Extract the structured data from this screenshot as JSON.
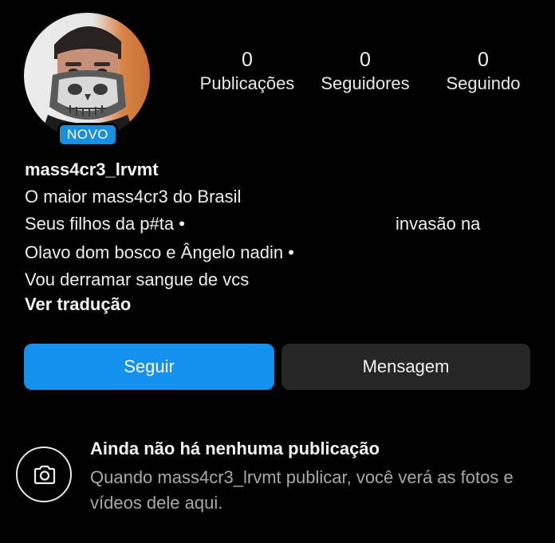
{
  "profile": {
    "badge": "NOVO",
    "username": "mass4cr3_lrvmt"
  },
  "stats": {
    "posts": {
      "count": "0",
      "label": "Publicações"
    },
    "followers": {
      "count": "0",
      "label": "Seguidores"
    },
    "following": {
      "count": "0",
      "label": "Seguindo"
    }
  },
  "bio": {
    "line1": "O maior mass4cr3 do Brasil",
    "line2a": "Seus filhos da p#ta •",
    "line2b": "invasão na",
    "line3": "Olavo dom bosco e Ângelo nadin •",
    "line4": "Vou derramar sangue de vcs",
    "translate": "Ver tradução"
  },
  "actions": {
    "follow": "Seguir",
    "message": "Mensagem"
  },
  "empty_state": {
    "title": "Ainda não há nenhuma publicação",
    "description": "Quando mass4cr3_lrvmt publicar, você verá as fotos e vídeos dele aqui.",
    "icon": "camera-icon"
  },
  "colors": {
    "background": "#000000",
    "primary_button": "#1591f0",
    "secondary_button": "#262626",
    "badge": "#1a8fe0",
    "muted_text": "#a8a8a8"
  }
}
